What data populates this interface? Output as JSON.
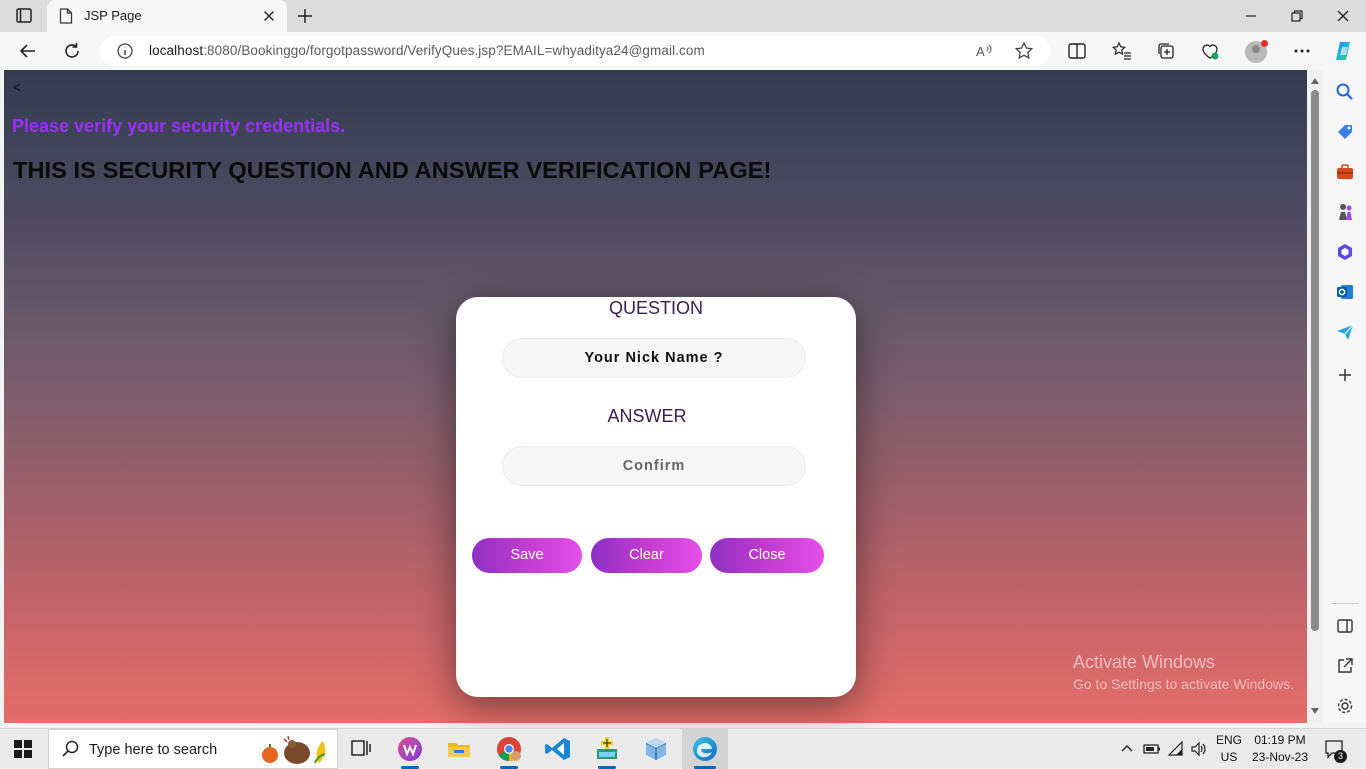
{
  "browser": {
    "tab_title": "JSP Page",
    "url_host": "localhost",
    "url_rest": ":8080/Bookinggo/forgotpassword/VerifyQues.jsp?EMAIL=whyaditya24@gmail.com"
  },
  "page": {
    "back_link": "<",
    "subtitle": "Please verify your security credentials.",
    "heading": "THIS IS SECURITY QUESTION AND ANSWER VERIFICATION PAGE!",
    "question_label": "QUESTION",
    "question_value": "Your Nick Name ?",
    "answer_label": "ANSWER",
    "answer_placeholder": "Confirm",
    "save_label": "Save",
    "clear_label": "Clear",
    "close_label": "Close"
  },
  "watermark": {
    "line1": "Activate Windows",
    "line2": "Go to Settings to activate Windows."
  },
  "taskbar": {
    "search_placeholder": "Type here to search",
    "lang_top": "ENG",
    "lang_bottom": "US",
    "time": "01:19 PM",
    "date": "23-Nov-23",
    "notification_count": "3"
  },
  "colors": {
    "accent_purple": "#9b30ff",
    "button_gradient_start": "#8f2fc5",
    "button_gradient_end": "#e54fe8",
    "edge_blue": "#0067c0"
  }
}
